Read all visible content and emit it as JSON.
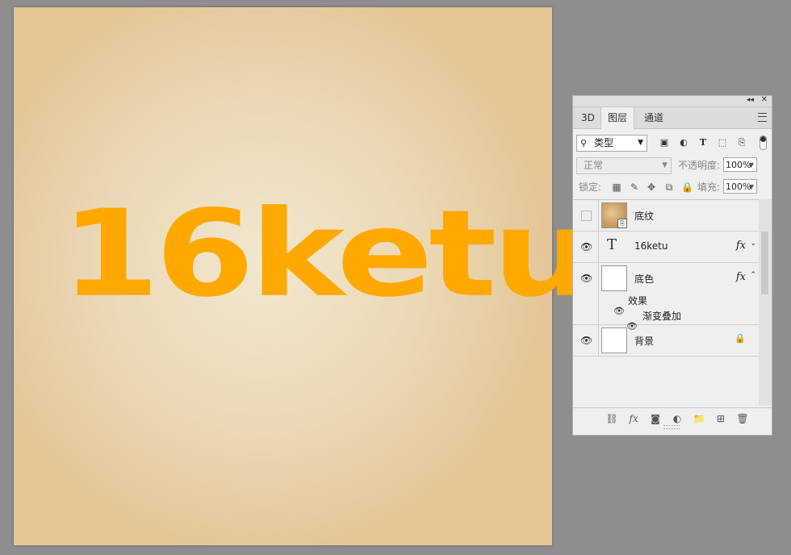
{
  "canvas": {
    "text": "16ketu",
    "text_color": "#ffa800"
  },
  "panel": {
    "tabs": [
      {
        "label": "3D"
      },
      {
        "label": "图层"
      },
      {
        "label": "通道"
      }
    ],
    "filter": {
      "kind_label": "类型",
      "icons": [
        "image-filter-icon",
        "adjustment-filter-icon",
        "type-filter-icon",
        "shape-filter-icon",
        "smart-object-filter-icon"
      ]
    },
    "blend": {
      "mode": "正常",
      "opacity_label": "不透明度:",
      "opacity": "100%"
    },
    "lock": {
      "label": "锁定:",
      "fill_label": "填充:",
      "fill": "100%"
    },
    "layers": [
      {
        "name": "底纹",
        "visible": false
      },
      {
        "name": "16ketu",
        "type_glyph": "T",
        "fx": "fx",
        "visible": true
      },
      {
        "name": "底色",
        "fx": "fx",
        "visible": true
      },
      {
        "name": "背景",
        "visible": true
      }
    ],
    "effects": {
      "label": "效果",
      "items": [
        "渐变叠加"
      ]
    }
  }
}
